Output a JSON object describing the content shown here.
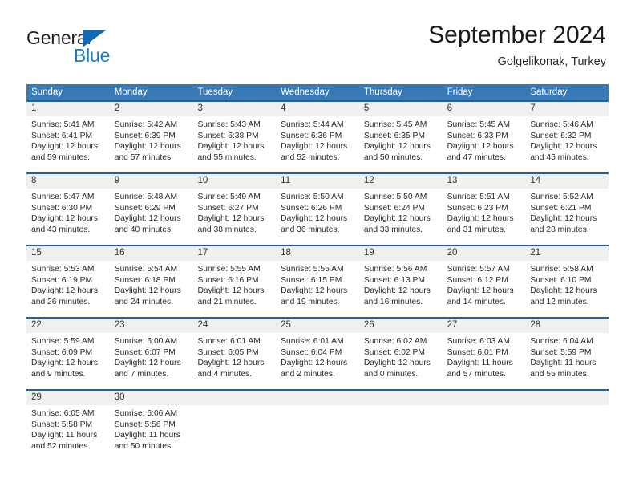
{
  "brand": {
    "name_primary": "General",
    "name_secondary": "Blue",
    "accent_color": "#1c7cc4"
  },
  "header": {
    "title": "September 2024",
    "subtitle": "Golgelikonak, Turkey"
  },
  "theme": {
    "header_row_color": "#3878b4",
    "day_band_border_color": "#1f5fa2",
    "day_band_color": "#f0f0f0"
  },
  "weekdays": [
    "Sunday",
    "Monday",
    "Tuesday",
    "Wednesday",
    "Thursday",
    "Friday",
    "Saturday"
  ],
  "weeks": [
    [
      {
        "day": "1",
        "sunrise": "Sunrise: 5:41 AM",
        "sunset": "Sunset: 6:41 PM",
        "daylight_line1": "Daylight: 12 hours",
        "daylight_line2": "and 59 minutes."
      },
      {
        "day": "2",
        "sunrise": "Sunrise: 5:42 AM",
        "sunset": "Sunset: 6:39 PM",
        "daylight_line1": "Daylight: 12 hours",
        "daylight_line2": "and 57 minutes."
      },
      {
        "day": "3",
        "sunrise": "Sunrise: 5:43 AM",
        "sunset": "Sunset: 6:38 PM",
        "daylight_line1": "Daylight: 12 hours",
        "daylight_line2": "and 55 minutes."
      },
      {
        "day": "4",
        "sunrise": "Sunrise: 5:44 AM",
        "sunset": "Sunset: 6:36 PM",
        "daylight_line1": "Daylight: 12 hours",
        "daylight_line2": "and 52 minutes."
      },
      {
        "day": "5",
        "sunrise": "Sunrise: 5:45 AM",
        "sunset": "Sunset: 6:35 PM",
        "daylight_line1": "Daylight: 12 hours",
        "daylight_line2": "and 50 minutes."
      },
      {
        "day": "6",
        "sunrise": "Sunrise: 5:45 AM",
        "sunset": "Sunset: 6:33 PM",
        "daylight_line1": "Daylight: 12 hours",
        "daylight_line2": "and 47 minutes."
      },
      {
        "day": "7",
        "sunrise": "Sunrise: 5:46 AM",
        "sunset": "Sunset: 6:32 PM",
        "daylight_line1": "Daylight: 12 hours",
        "daylight_line2": "and 45 minutes."
      }
    ],
    [
      {
        "day": "8",
        "sunrise": "Sunrise: 5:47 AM",
        "sunset": "Sunset: 6:30 PM",
        "daylight_line1": "Daylight: 12 hours",
        "daylight_line2": "and 43 minutes."
      },
      {
        "day": "9",
        "sunrise": "Sunrise: 5:48 AM",
        "sunset": "Sunset: 6:29 PM",
        "daylight_line1": "Daylight: 12 hours",
        "daylight_line2": "and 40 minutes."
      },
      {
        "day": "10",
        "sunrise": "Sunrise: 5:49 AM",
        "sunset": "Sunset: 6:27 PM",
        "daylight_line1": "Daylight: 12 hours",
        "daylight_line2": "and 38 minutes."
      },
      {
        "day": "11",
        "sunrise": "Sunrise: 5:50 AM",
        "sunset": "Sunset: 6:26 PM",
        "daylight_line1": "Daylight: 12 hours",
        "daylight_line2": "and 36 minutes."
      },
      {
        "day": "12",
        "sunrise": "Sunrise: 5:50 AM",
        "sunset": "Sunset: 6:24 PM",
        "daylight_line1": "Daylight: 12 hours",
        "daylight_line2": "and 33 minutes."
      },
      {
        "day": "13",
        "sunrise": "Sunrise: 5:51 AM",
        "sunset": "Sunset: 6:23 PM",
        "daylight_line1": "Daylight: 12 hours",
        "daylight_line2": "and 31 minutes."
      },
      {
        "day": "14",
        "sunrise": "Sunrise: 5:52 AM",
        "sunset": "Sunset: 6:21 PM",
        "daylight_line1": "Daylight: 12 hours",
        "daylight_line2": "and 28 minutes."
      }
    ],
    [
      {
        "day": "15",
        "sunrise": "Sunrise: 5:53 AM",
        "sunset": "Sunset: 6:19 PM",
        "daylight_line1": "Daylight: 12 hours",
        "daylight_line2": "and 26 minutes."
      },
      {
        "day": "16",
        "sunrise": "Sunrise: 5:54 AM",
        "sunset": "Sunset: 6:18 PM",
        "daylight_line1": "Daylight: 12 hours",
        "daylight_line2": "and 24 minutes."
      },
      {
        "day": "17",
        "sunrise": "Sunrise: 5:55 AM",
        "sunset": "Sunset: 6:16 PM",
        "daylight_line1": "Daylight: 12 hours",
        "daylight_line2": "and 21 minutes."
      },
      {
        "day": "18",
        "sunrise": "Sunrise: 5:55 AM",
        "sunset": "Sunset: 6:15 PM",
        "daylight_line1": "Daylight: 12 hours",
        "daylight_line2": "and 19 minutes."
      },
      {
        "day": "19",
        "sunrise": "Sunrise: 5:56 AM",
        "sunset": "Sunset: 6:13 PM",
        "daylight_line1": "Daylight: 12 hours",
        "daylight_line2": "and 16 minutes."
      },
      {
        "day": "20",
        "sunrise": "Sunrise: 5:57 AM",
        "sunset": "Sunset: 6:12 PM",
        "daylight_line1": "Daylight: 12 hours",
        "daylight_line2": "and 14 minutes."
      },
      {
        "day": "21",
        "sunrise": "Sunrise: 5:58 AM",
        "sunset": "Sunset: 6:10 PM",
        "daylight_line1": "Daylight: 12 hours",
        "daylight_line2": "and 12 minutes."
      }
    ],
    [
      {
        "day": "22",
        "sunrise": "Sunrise: 5:59 AM",
        "sunset": "Sunset: 6:09 PM",
        "daylight_line1": "Daylight: 12 hours",
        "daylight_line2": "and 9 minutes."
      },
      {
        "day": "23",
        "sunrise": "Sunrise: 6:00 AM",
        "sunset": "Sunset: 6:07 PM",
        "daylight_line1": "Daylight: 12 hours",
        "daylight_line2": "and 7 minutes."
      },
      {
        "day": "24",
        "sunrise": "Sunrise: 6:01 AM",
        "sunset": "Sunset: 6:05 PM",
        "daylight_line1": "Daylight: 12 hours",
        "daylight_line2": "and 4 minutes."
      },
      {
        "day": "25",
        "sunrise": "Sunrise: 6:01 AM",
        "sunset": "Sunset: 6:04 PM",
        "daylight_line1": "Daylight: 12 hours",
        "daylight_line2": "and 2 minutes."
      },
      {
        "day": "26",
        "sunrise": "Sunrise: 6:02 AM",
        "sunset": "Sunset: 6:02 PM",
        "daylight_line1": "Daylight: 12 hours",
        "daylight_line2": "and 0 minutes."
      },
      {
        "day": "27",
        "sunrise": "Sunrise: 6:03 AM",
        "sunset": "Sunset: 6:01 PM",
        "daylight_line1": "Daylight: 11 hours",
        "daylight_line2": "and 57 minutes."
      },
      {
        "day": "28",
        "sunrise": "Sunrise: 6:04 AM",
        "sunset": "Sunset: 5:59 PM",
        "daylight_line1": "Daylight: 11 hours",
        "daylight_line2": "and 55 minutes."
      }
    ],
    [
      {
        "day": "29",
        "sunrise": "Sunrise: 6:05 AM",
        "sunset": "Sunset: 5:58 PM",
        "daylight_line1": "Daylight: 11 hours",
        "daylight_line2": "and 52 minutes."
      },
      {
        "day": "30",
        "sunrise": "Sunrise: 6:06 AM",
        "sunset": "Sunset: 5:56 PM",
        "daylight_line1": "Daylight: 11 hours",
        "daylight_line2": "and 50 minutes."
      },
      {
        "day": "",
        "sunrise": "",
        "sunset": "",
        "daylight_line1": "",
        "daylight_line2": ""
      },
      {
        "day": "",
        "sunrise": "",
        "sunset": "",
        "daylight_line1": "",
        "daylight_line2": ""
      },
      {
        "day": "",
        "sunrise": "",
        "sunset": "",
        "daylight_line1": "",
        "daylight_line2": ""
      },
      {
        "day": "",
        "sunrise": "",
        "sunset": "",
        "daylight_line1": "",
        "daylight_line2": ""
      },
      {
        "day": "",
        "sunrise": "",
        "sunset": "",
        "daylight_line1": "",
        "daylight_line2": ""
      }
    ]
  ]
}
